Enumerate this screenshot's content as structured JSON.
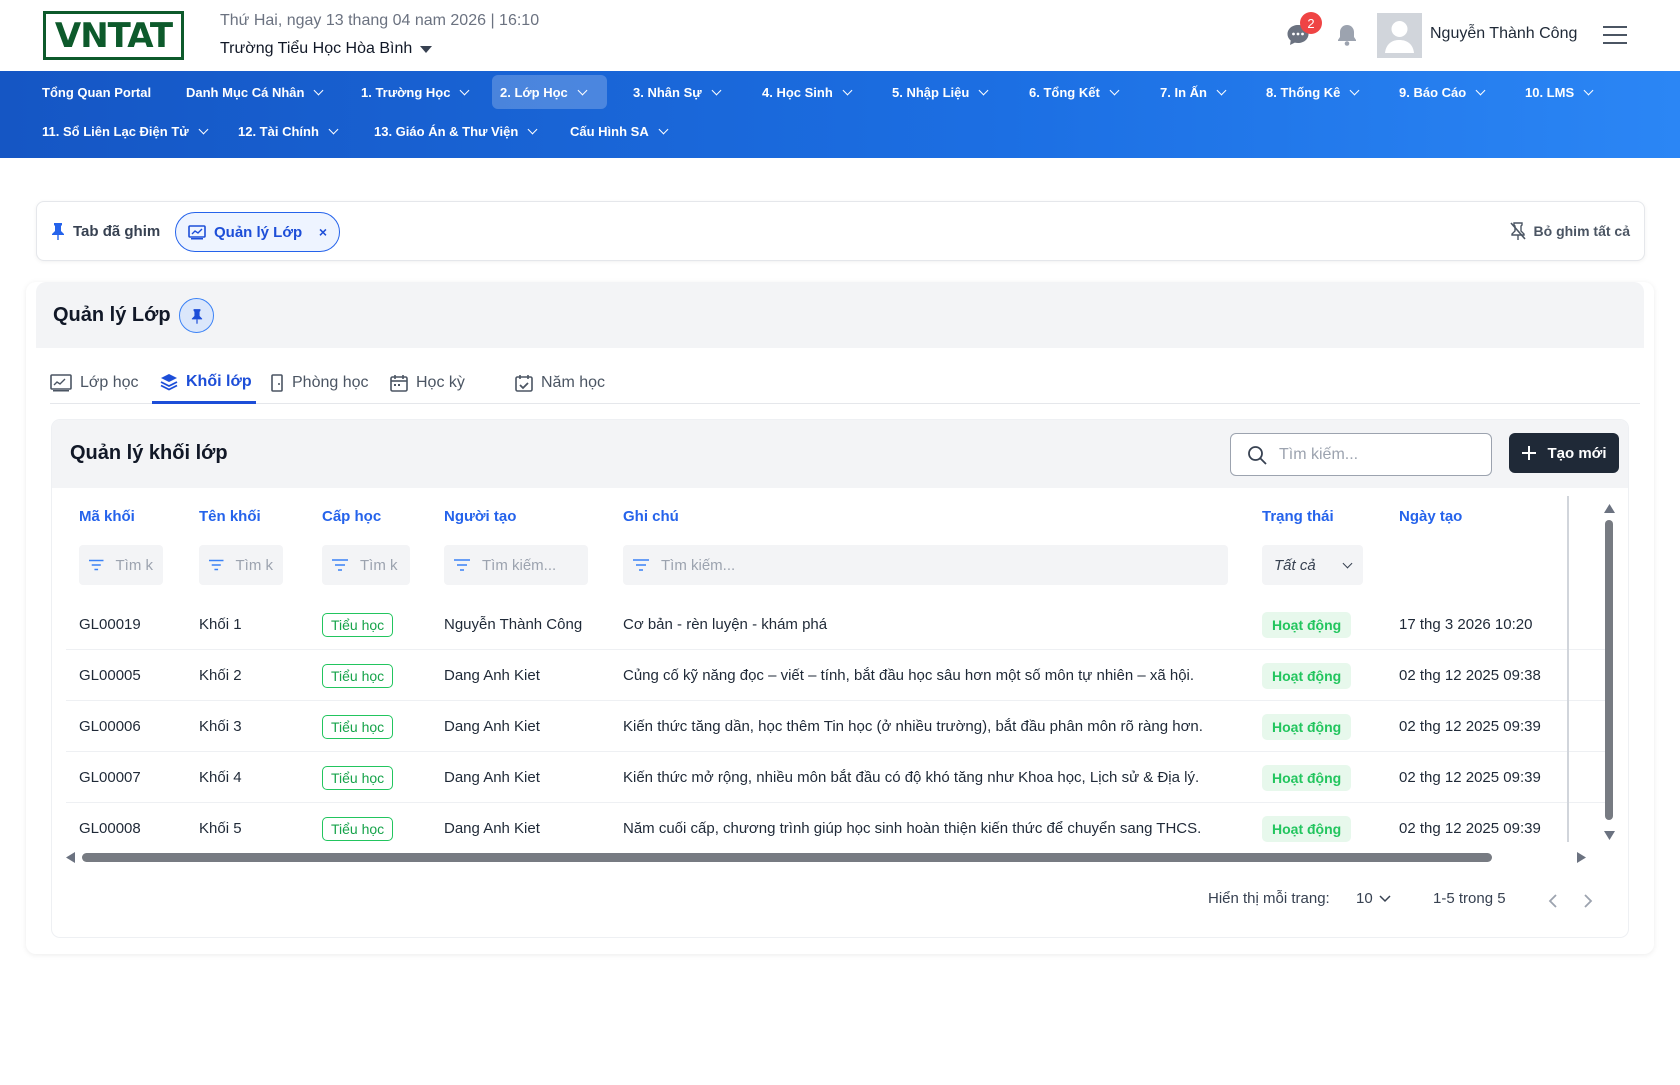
{
  "header": {
    "logo_text": "VNTAT",
    "date_line": "Thứ Hai, ngay 13 thang 04 nam 2026 | 16:10",
    "school_name": "Trường Tiểu Học Hòa Bình",
    "message_badge": "2",
    "user_name": "Nguyễn Thành Công"
  },
  "nav": {
    "row1": [
      {
        "label": "Tổng Quan Portal",
        "dropdown": false
      },
      {
        "label": "Danh Mục Cá Nhân",
        "dropdown": true
      },
      {
        "label": "1. Trường Học",
        "dropdown": true
      },
      {
        "label": "2. Lớp Học",
        "dropdown": true,
        "active": true
      },
      {
        "label": "3. Nhân Sự",
        "dropdown": true
      },
      {
        "label": "4. Học Sinh",
        "dropdown": true
      },
      {
        "label": "5. Nhập Liệu",
        "dropdown": true
      },
      {
        "label": "6. Tổng Kết",
        "dropdown": true
      },
      {
        "label": "7. In Ấn",
        "dropdown": true
      },
      {
        "label": "8. Thống Kê",
        "dropdown": true
      },
      {
        "label": "9. Báo Cáo",
        "dropdown": true
      },
      {
        "label": "10. LMS",
        "dropdown": true
      }
    ],
    "row2": [
      {
        "label": "11. Sổ Liên Lạc Điện Tử",
        "dropdown": true
      },
      {
        "label": "12. Tài Chính",
        "dropdown": true
      },
      {
        "label": "13. Giáo Án & Thư Viện",
        "dropdown": true
      },
      {
        "label": "Cấu Hình SA",
        "dropdown": true
      }
    ]
  },
  "pinned": {
    "label": "Tab đã ghim",
    "chip_label": "Quản lý Lớp",
    "chip_close": "×",
    "unpin_all": "Bỏ ghim tất cả"
  },
  "panel": {
    "title": "Quản lý Lớp",
    "tabs": [
      {
        "label": "Lớp học",
        "icon": "classroom-icon"
      },
      {
        "label": "Khối lớp",
        "icon": "layers-icon",
        "active": true
      },
      {
        "label": "Phòng học",
        "icon": "door-icon"
      },
      {
        "label": "Học kỳ",
        "icon": "calendar-icon"
      },
      {
        "label": "Năm học",
        "icon": "calendar-check-icon"
      }
    ]
  },
  "card": {
    "title": "Quản lý khối lớp",
    "search_placeholder": "Tìm kiếm...",
    "create_label": "Tạo mới"
  },
  "table": {
    "columns": [
      "Mã khối",
      "Tên khối",
      "Cấp học",
      "Người tạo",
      "Ghi chú",
      "Trạng thái",
      "Ngày tạo"
    ],
    "filter_placeholders": [
      "Tìm k",
      "Tìm k",
      "Tìm k",
      "Tìm kiếm...",
      "Tìm kiếm..."
    ],
    "status_filter": "Tất cả",
    "rows": [
      {
        "code": "GL00019",
        "name": "Khối 1",
        "level": "Tiểu học",
        "creator": "Nguyễn Thành Công",
        "note": "Cơ bản - rèn luyện - khám phá",
        "status": "Hoạt động",
        "created": "17 thg 3 2026 10:20"
      },
      {
        "code": "GL00005",
        "name": "Khối 2",
        "level": "Tiểu học",
        "creator": "Dang Anh Kiet",
        "note": "Củng cố kỹ năng đọc – viết – tính, bắt đầu học sâu hơn một số môn tự nhiên – xã hội.",
        "status": "Hoạt động",
        "created": "02 thg 12 2025 09:38"
      },
      {
        "code": "GL00006",
        "name": "Khối 3",
        "level": "Tiểu học",
        "creator": "Dang Anh Kiet",
        "note": "Kiến thức tăng dần, học thêm Tin học (ở nhiều trường), bắt đầu phân môn rõ ràng hơn.",
        "status": "Hoạt động",
        "created": "02 thg 12 2025 09:39"
      },
      {
        "code": "GL00007",
        "name": "Khối 4",
        "level": "Tiểu học",
        "creator": "Dang Anh Kiet",
        "note": "Kiến thức mở rộng, nhiều môn bắt đầu có độ khó tăng như Khoa học, Lịch sử & Địa lý.",
        "status": "Hoạt động",
        "created": "02 thg 12 2025 09:39"
      },
      {
        "code": "GL00008",
        "name": "Khối 5",
        "level": "Tiểu học",
        "creator": "Dang Anh Kiet",
        "note": "Năm cuối cấp, chương trình giúp học sinh hoàn thiện kiến thức để chuyển sang THCS.",
        "status": "Hoạt động",
        "created": "02 thg 12 2025 09:39"
      }
    ]
  },
  "pagination": {
    "per_page_label": "Hiển thị mỗi trang:",
    "per_page_value": "10",
    "range": "1-5 trong 5"
  },
  "colors": {
    "nav_start": "#1556c4",
    "nav_end": "#2b86f5",
    "accent": "#2563eb",
    "status_green": "#22c55e",
    "primary_button": "#1f2937"
  }
}
